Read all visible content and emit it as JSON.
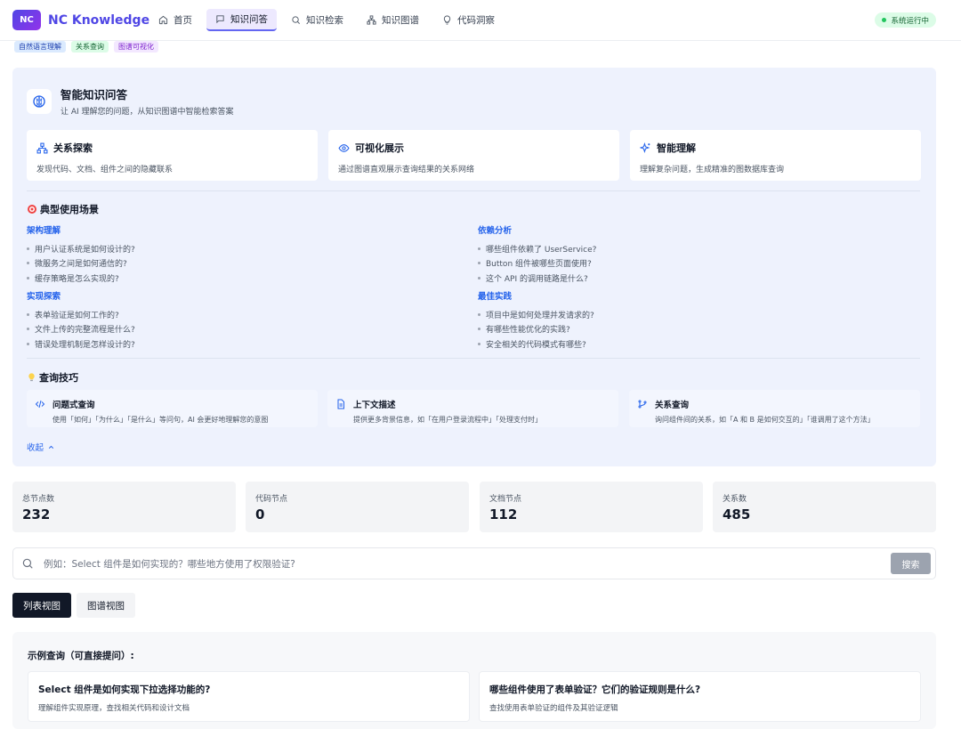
{
  "header": {
    "logo_text": "NC",
    "brand": "NC Knowledge",
    "nav": [
      {
        "label": "首页",
        "icon": "home-icon"
      },
      {
        "label": "知识问答",
        "icon": "chat-icon"
      },
      {
        "label": "知识检索",
        "icon": "search-icon"
      },
      {
        "label": "知识图谱",
        "icon": "graph-icon"
      },
      {
        "label": "代码洞察",
        "icon": "lightbulb-icon"
      }
    ],
    "active_nav": "知识问答",
    "status": "系统运行中"
  },
  "tags": [
    "自然语言理解",
    "关系查询",
    "图谱可视化"
  ],
  "intro": {
    "title": "智能知识问答",
    "subtitle": "让 AI 理解您的问题，从知识图谱中智能检索答案",
    "features": [
      {
        "title": "关系探索",
        "desc": "发现代码、文档、组件之间的隐藏联系",
        "icon": "network-icon"
      },
      {
        "title": "可视化展示",
        "desc": "通过图谱直观展示查询结果的关系网络",
        "icon": "eye-icon"
      },
      {
        "title": "智能理解",
        "desc": "理解复杂问题，生成精准的图数据库查询",
        "icon": "sparkles-icon"
      }
    ],
    "scenarios_title": "典型使用场景",
    "scenarios": [
      {
        "heading": "架构理解",
        "items": [
          "用户认证系统是如何设计的?",
          "微服务之间是如何通信的?",
          "缓存策略是怎么实现的?"
        ]
      },
      {
        "heading": "依赖分析",
        "items": [
          "哪些组件依赖了 UserService?",
          "Button 组件被哪些页面使用?",
          "这个 API 的调用链路是什么?"
        ]
      },
      {
        "heading": "实现探索",
        "items": [
          "表单验证是如何工作的?",
          "文件上传的完整流程是什么?",
          "错误处理机制是怎样设计的?"
        ]
      },
      {
        "heading": "最佳实践",
        "items": [
          "项目中是如何处理并发请求的?",
          "有哪些性能优化的实践?",
          "安全相关的代码模式有哪些?"
        ]
      }
    ],
    "tips_title": "查询技巧",
    "tips": [
      {
        "title": "问题式查询",
        "desc": "使用「如何」「为什么」「是什么」等问句，AI 会更好地理解您的意图",
        "icon": "code-icon"
      },
      {
        "title": "上下文描述",
        "desc": "提供更多背景信息，如「在用户登录流程中」「处理支付时」",
        "icon": "document-icon"
      },
      {
        "title": "关系查询",
        "desc": "询问组件间的关系，如「A 和 B 是如何交互的」「谁调用了这个方法」",
        "icon": "branch-icon"
      }
    ],
    "collapse_label": "收起"
  },
  "stats": [
    {
      "label": "总节点数",
      "value": "232"
    },
    {
      "label": "代码节点",
      "value": "0"
    },
    {
      "label": "文档节点",
      "value": "112"
    },
    {
      "label": "关系数",
      "value": "485"
    }
  ],
  "search": {
    "placeholder": "例如：Select 组件是如何实现的？哪些地方使用了权限验证?",
    "value": "",
    "button": "搜索"
  },
  "view_tabs": {
    "list": "列表视图",
    "graph": "图谱视图"
  },
  "examples": {
    "heading": "示例查询（可直接提问）:",
    "items": [
      {
        "title": "Select 组件是如何实现下拉选择功能的?",
        "desc": "理解组件实现原理，查找相关代码和设计文档"
      },
      {
        "title": "哪些组件使用了表单验证？它们的验证规则是什么?",
        "desc": "查找使用表单验证的组件及其验证逻辑"
      }
    ]
  }
}
